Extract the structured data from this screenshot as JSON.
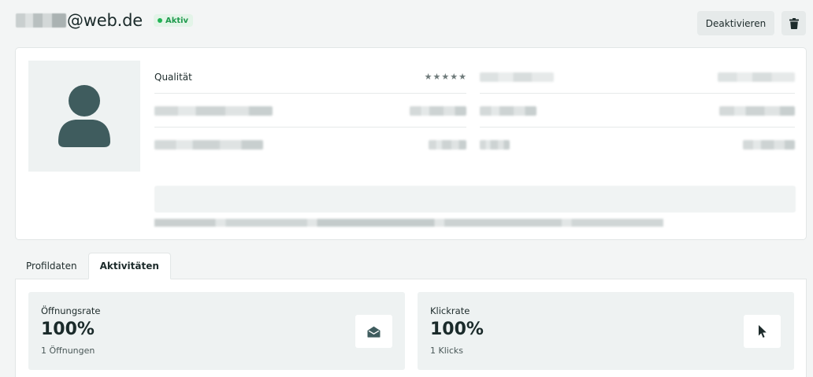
{
  "header": {
    "title_domain": "@web.de",
    "status": "Aktiv",
    "deactivate_label": "Deaktivieren"
  },
  "profile": {
    "quality_label": "Qualität",
    "quality_stars": 5
  },
  "tabs": [
    {
      "label": "Profildaten",
      "active": false
    },
    {
      "label": "Aktivitäten",
      "active": true
    }
  ],
  "stats": [
    {
      "label": "Öffnungsrate",
      "value": "100%",
      "sub": "1 Öffnungen",
      "icon": "envelope-open-icon"
    },
    {
      "label": "Klickrate",
      "value": "100%",
      "sub": "1 Klicks",
      "icon": "cursor-icon"
    }
  ],
  "colors": {
    "accent_dark": "#3f5c5e",
    "status_green": "#22b455",
    "badge_bg": "#e3f4e8"
  }
}
